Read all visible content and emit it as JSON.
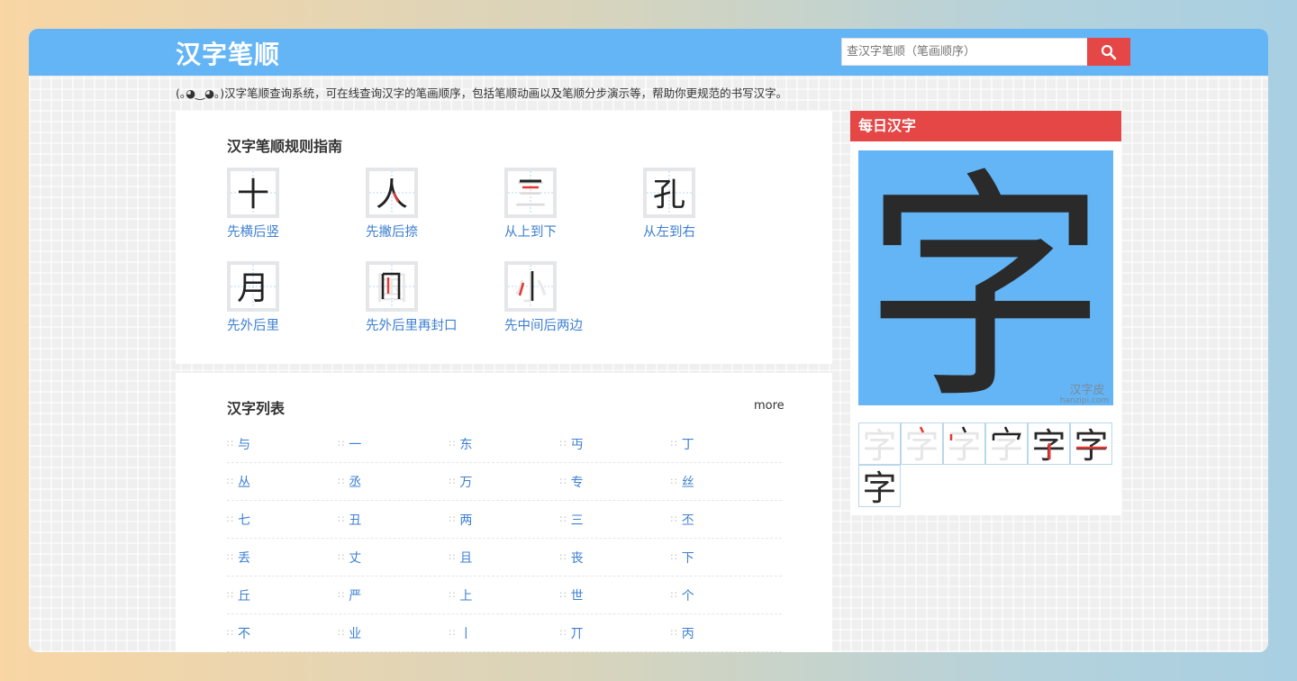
{
  "header": {
    "site_title": "汉字笔顺",
    "search": {
      "placeholder": "查汉字笔顺（笔画顺序）",
      "button_icon": "search-icon"
    }
  },
  "intro": "(｡◕‿◕｡)汉字笔顺查询系统，可在线查询汉字的笔画顺序，包括笔顺动画以及笔顺分步演示等，帮助你更规范的书写汉字。",
  "rules": {
    "title": "汉字笔顺规则指南",
    "items": [
      {
        "char": "十",
        "label": "先横后竖"
      },
      {
        "char": "人",
        "label": "先撇后捺"
      },
      {
        "char": "三",
        "label": "从上到下"
      },
      {
        "char": "孔",
        "label": "从左到右"
      },
      {
        "char": "月",
        "label": "先外后里"
      },
      {
        "char": "国",
        "label": "先外后里再封口"
      },
      {
        "char": "小",
        "label": "先中间后两边"
      }
    ]
  },
  "char_list": {
    "title": "汉字列表",
    "more_label": "more",
    "dots": "∷",
    "rows": [
      [
        "与",
        "一",
        "东",
        "丏",
        "丁"
      ],
      [
        "丛",
        "丞",
        "万",
        "专",
        "丝"
      ],
      [
        "七",
        "丑",
        "两",
        "三",
        "丕"
      ],
      [
        "丢",
        "丈",
        "且",
        "丧",
        "下"
      ],
      [
        "丘",
        "严",
        "上",
        "世",
        "个"
      ],
      [
        "不",
        "业",
        "丨",
        "丌",
        "丙"
      ]
    ]
  },
  "daily": {
    "title": "每日汉字",
    "char": "字",
    "watermark_cn": "汉字皮",
    "watermark_url": "hanzipi.com"
  },
  "colors": {
    "header_bg": "#64b5f6",
    "accent_red": "#e54646",
    "link_blue": "#3d7fd1",
    "stroke_highlight": "#e53935"
  }
}
